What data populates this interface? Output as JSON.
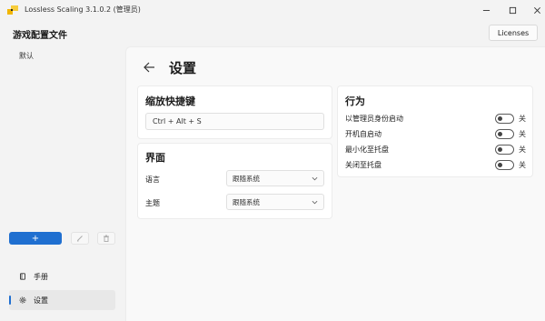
{
  "window": {
    "title": "Lossless Scaling 3.1.0.2 (管理员)",
    "controls": [
      "minimize-icon",
      "maximize-icon",
      "close-icon"
    ]
  },
  "sidebar": {
    "title": "游戏配置文件",
    "profiles": [
      "默认"
    ],
    "add_label": "+",
    "nav": [
      {
        "label": "手册",
        "icon": "book-icon",
        "selected": false
      },
      {
        "label": "设置",
        "icon": "gear-icon",
        "selected": true
      }
    ]
  },
  "header": {
    "licenses_label": "Licenses"
  },
  "settings": {
    "title": "设置",
    "hotkey": {
      "title": "缩放快捷键",
      "value": "Ctrl + Alt + S"
    },
    "interface": {
      "title": "界面",
      "rows": [
        {
          "label": "语言",
          "value": "跟随系统"
        },
        {
          "label": "主题",
          "value": "跟随系统"
        }
      ]
    },
    "behavior": {
      "title": "行为",
      "rows": [
        {
          "label": "以管理员身份启动",
          "state": "关"
        },
        {
          "label": "开机自启动",
          "state": "关"
        },
        {
          "label": "最小化至托盘",
          "state": "关"
        },
        {
          "label": "关闭至托盘",
          "state": "关"
        }
      ]
    }
  },
  "colors": {
    "accent": "#1f6fd0",
    "background": "#f3f3f3",
    "card": "#ffffff"
  }
}
